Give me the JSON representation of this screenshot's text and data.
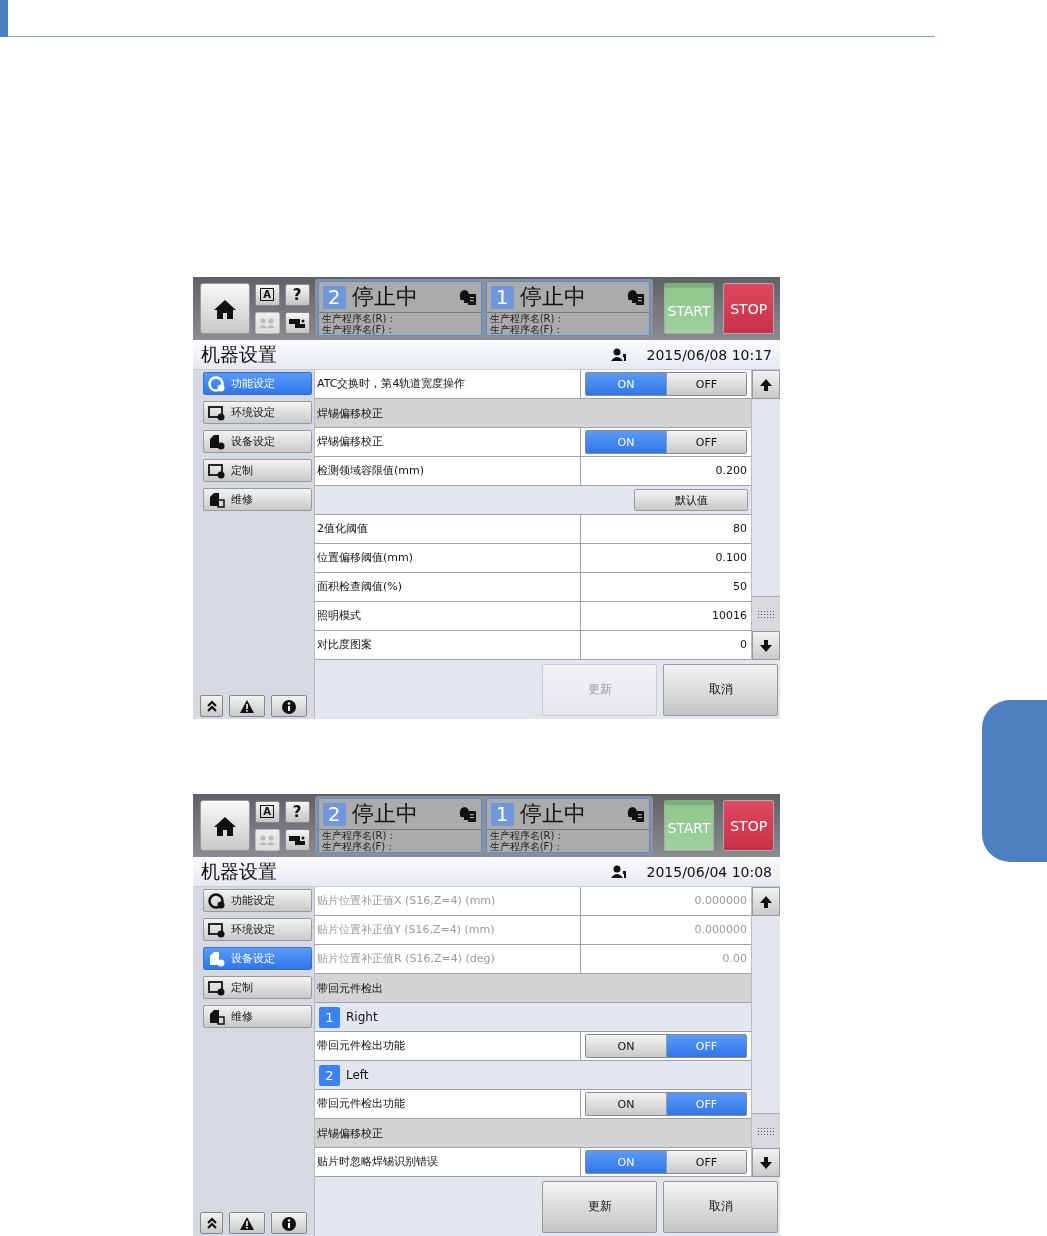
{
  "screens": [
    {
      "header": {
        "small_buttons": [
          {
            "kind": "language",
            "label": "A",
            "disabled": false
          },
          {
            "kind": "help",
            "label": "?",
            "disabled": false
          },
          {
            "kind": "operators",
            "disabled": true
          },
          {
            "kind": "network",
            "disabled": false
          }
        ],
        "panels": [
          {
            "number": "2",
            "status": "停止中",
            "lines": [
              "生产程序名(R) :",
              "生产程序名(F) :"
            ]
          },
          {
            "number": "1",
            "status": "停止中",
            "lines": [
              "生产程序名(R) :",
              "生产程序名(F) :"
            ]
          }
        ],
        "start": "START",
        "stop": "STOP"
      },
      "title": "机器设置",
      "datetime": "2015/06/08 10:17",
      "nav": [
        {
          "label": "功能设定",
          "selected": true
        },
        {
          "label": "环境设定",
          "selected": false
        },
        {
          "label": "设备设定",
          "selected": false
        },
        {
          "label": "定制",
          "selected": false
        },
        {
          "label": "维修",
          "selected": false
        }
      ],
      "rows": [
        {
          "kind": "toggle",
          "label": "ATC交换时，第4轨道宽度操作",
          "on": true,
          "on_label": "ON",
          "off_label": "OFF",
          "disabled": false
        },
        {
          "kind": "section",
          "label": "焊锡偏移校正",
          "disabled": false
        },
        {
          "kind": "toggle",
          "label": "焊锡偏移校正",
          "on": true,
          "on_label": "ON",
          "off_label": "OFF",
          "disabled": false
        },
        {
          "kind": "value",
          "label": "检测领域容限值(mm)",
          "value": "0.200",
          "disabled": false
        },
        {
          "kind": "button",
          "label": "默认值",
          "disabled": false
        },
        {
          "kind": "value",
          "label": "2值化阈值",
          "value": "80",
          "disabled": false
        },
        {
          "kind": "value",
          "label": "位置偏移阈值(mm)",
          "value": "0.100",
          "disabled": false
        },
        {
          "kind": "value",
          "label": "面积检查阈值(%)",
          "value": "50",
          "disabled": false
        },
        {
          "kind": "value",
          "label": "照明模式",
          "value": "10016",
          "disabled": false
        },
        {
          "kind": "value",
          "label": "对比度图案",
          "value": "0",
          "disabled": false
        }
      ],
      "actions": [
        {
          "label": "更新",
          "disabled": true
        },
        {
          "label": "取消",
          "disabled": false
        }
      ]
    },
    {
      "header": {
        "small_buttons": [
          {
            "kind": "language",
            "label": "A",
            "disabled": false
          },
          {
            "kind": "help",
            "label": "?",
            "disabled": false
          },
          {
            "kind": "operators",
            "disabled": true
          },
          {
            "kind": "network",
            "disabled": false
          }
        ],
        "panels": [
          {
            "number": "2",
            "status": "停止中",
            "lines": [
              "生产程序名(R) :",
              "生产程序名(F) :"
            ]
          },
          {
            "number": "1",
            "status": "停止中",
            "lines": [
              "生产程序名(R) :",
              "生产程序名(F) :"
            ]
          }
        ],
        "start": "START",
        "stop": "STOP"
      },
      "title": "机器设置",
      "datetime": "2015/06/04 10:08",
      "nav": [
        {
          "label": "功能设定",
          "selected": false
        },
        {
          "label": "环境设定",
          "selected": false
        },
        {
          "label": "设备设定",
          "selected": true
        },
        {
          "label": "定制",
          "selected": false
        },
        {
          "label": "维修",
          "selected": false
        }
      ],
      "rows": [
        {
          "kind": "value",
          "label": "贴片位置补正值X (S16,Z=4) (mm)",
          "value": "0.000000",
          "disabled": true
        },
        {
          "kind": "value",
          "label": "贴片位置补正值Y (S16,Z=4) (mm)",
          "value": "0.000000",
          "disabled": true
        },
        {
          "kind": "value",
          "label": "贴片位置补正值R (S16,Z=4) (deg)",
          "value": "0.00",
          "disabled": true
        },
        {
          "kind": "section",
          "label": "带回元件检出",
          "disabled": false
        },
        {
          "kind": "group",
          "number": "1",
          "label": "Right",
          "disabled": false
        },
        {
          "kind": "toggle",
          "label": "带回元件检出功能",
          "on": false,
          "on_label": "ON",
          "off_label": "OFF",
          "disabled": false
        },
        {
          "kind": "group",
          "number": "2",
          "label": "Left",
          "disabled": false
        },
        {
          "kind": "toggle",
          "label": "带回元件检出功能",
          "on": false,
          "on_label": "ON",
          "off_label": "OFF",
          "disabled": false
        },
        {
          "kind": "section",
          "label": "焊锡偏移校正",
          "disabled": false
        },
        {
          "kind": "toggle",
          "label": "贴片时忽略焊锡识别错误",
          "on": true,
          "on_label": "ON",
          "off_label": "OFF",
          "disabled": false
        }
      ],
      "actions": [
        {
          "label": "更新",
          "disabled": false
        },
        {
          "label": "取消",
          "disabled": false
        }
      ]
    }
  ]
}
